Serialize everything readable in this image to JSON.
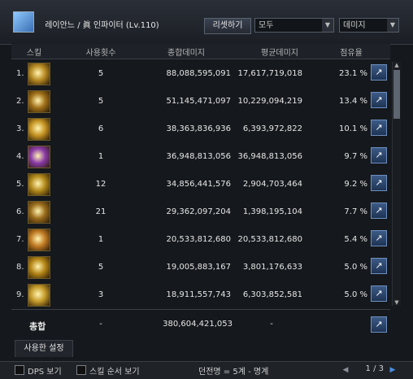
{
  "header": {
    "character_name": "ᅠ레이안느",
    "separator": "/",
    "class_name": "眞 인파이터 (Lv.110)",
    "reset_label": "리셋하기",
    "filter_value": "모두",
    "metric_value": "데미지"
  },
  "columns": [
    "스킬",
    "사용횟수",
    "종합데미지",
    "평균데미지",
    "점유율"
  ],
  "rows": [
    {
      "rank": "1.",
      "uses": "5",
      "total": "88,088,595,091",
      "avg": "17,617,719,018",
      "share": "23.1 %",
      "color": "#b78a23"
    },
    {
      "rank": "2.",
      "uses": "5",
      "total": "51,145,471,097",
      "avg": "10,229,094,219",
      "share": "13.4 %",
      "color": "#a07018"
    },
    {
      "rank": "3.",
      "uses": "6",
      "total": "38,363,836,936",
      "avg": "6,393,972,822",
      "share": "10.1 %",
      "color": "#c59322"
    },
    {
      "rank": "4.",
      "uses": "1",
      "total": "36,948,813,056",
      "avg": "36,948,813,056",
      "share": "9.7 %",
      "color": "#8a3aa8"
    },
    {
      "rank": "5.",
      "uses": "12",
      "total": "34,856,441,576",
      "avg": "2,904,703,464",
      "share": "9.2 %",
      "color": "#b38a1c"
    },
    {
      "rank": "6.",
      "uses": "21",
      "total": "29,362,097,204",
      "avg": "1,398,195,104",
      "share": "7.7 %",
      "color": "#9a6c1c"
    },
    {
      "rank": "7.",
      "uses": "1",
      "total": "20,533,812,680",
      "avg": "20,533,812,680",
      "share": "5.4 %",
      "color": "#c07a22"
    },
    {
      "rank": "8.",
      "uses": "5",
      "total": "19,005,883,167",
      "avg": "3,801,176,633",
      "share": "5.0 %",
      "color": "#b48516"
    },
    {
      "rank": "9.",
      "uses": "3",
      "total": "18,911,557,743",
      "avg": "6,303,852,581",
      "share": "5.0 %",
      "color": "#c49a2a"
    }
  ],
  "total": {
    "label": "총합",
    "uses": "-",
    "total": "380,604,421,053",
    "avg": "-"
  },
  "tab_label": "사용한 설정",
  "footer": {
    "dps_label": "DPS 보기",
    "order_label": "스킬 순서 보기",
    "dungeon_text": "던전명 = 5계 - 명계",
    "page_text": "1 / 3"
  }
}
